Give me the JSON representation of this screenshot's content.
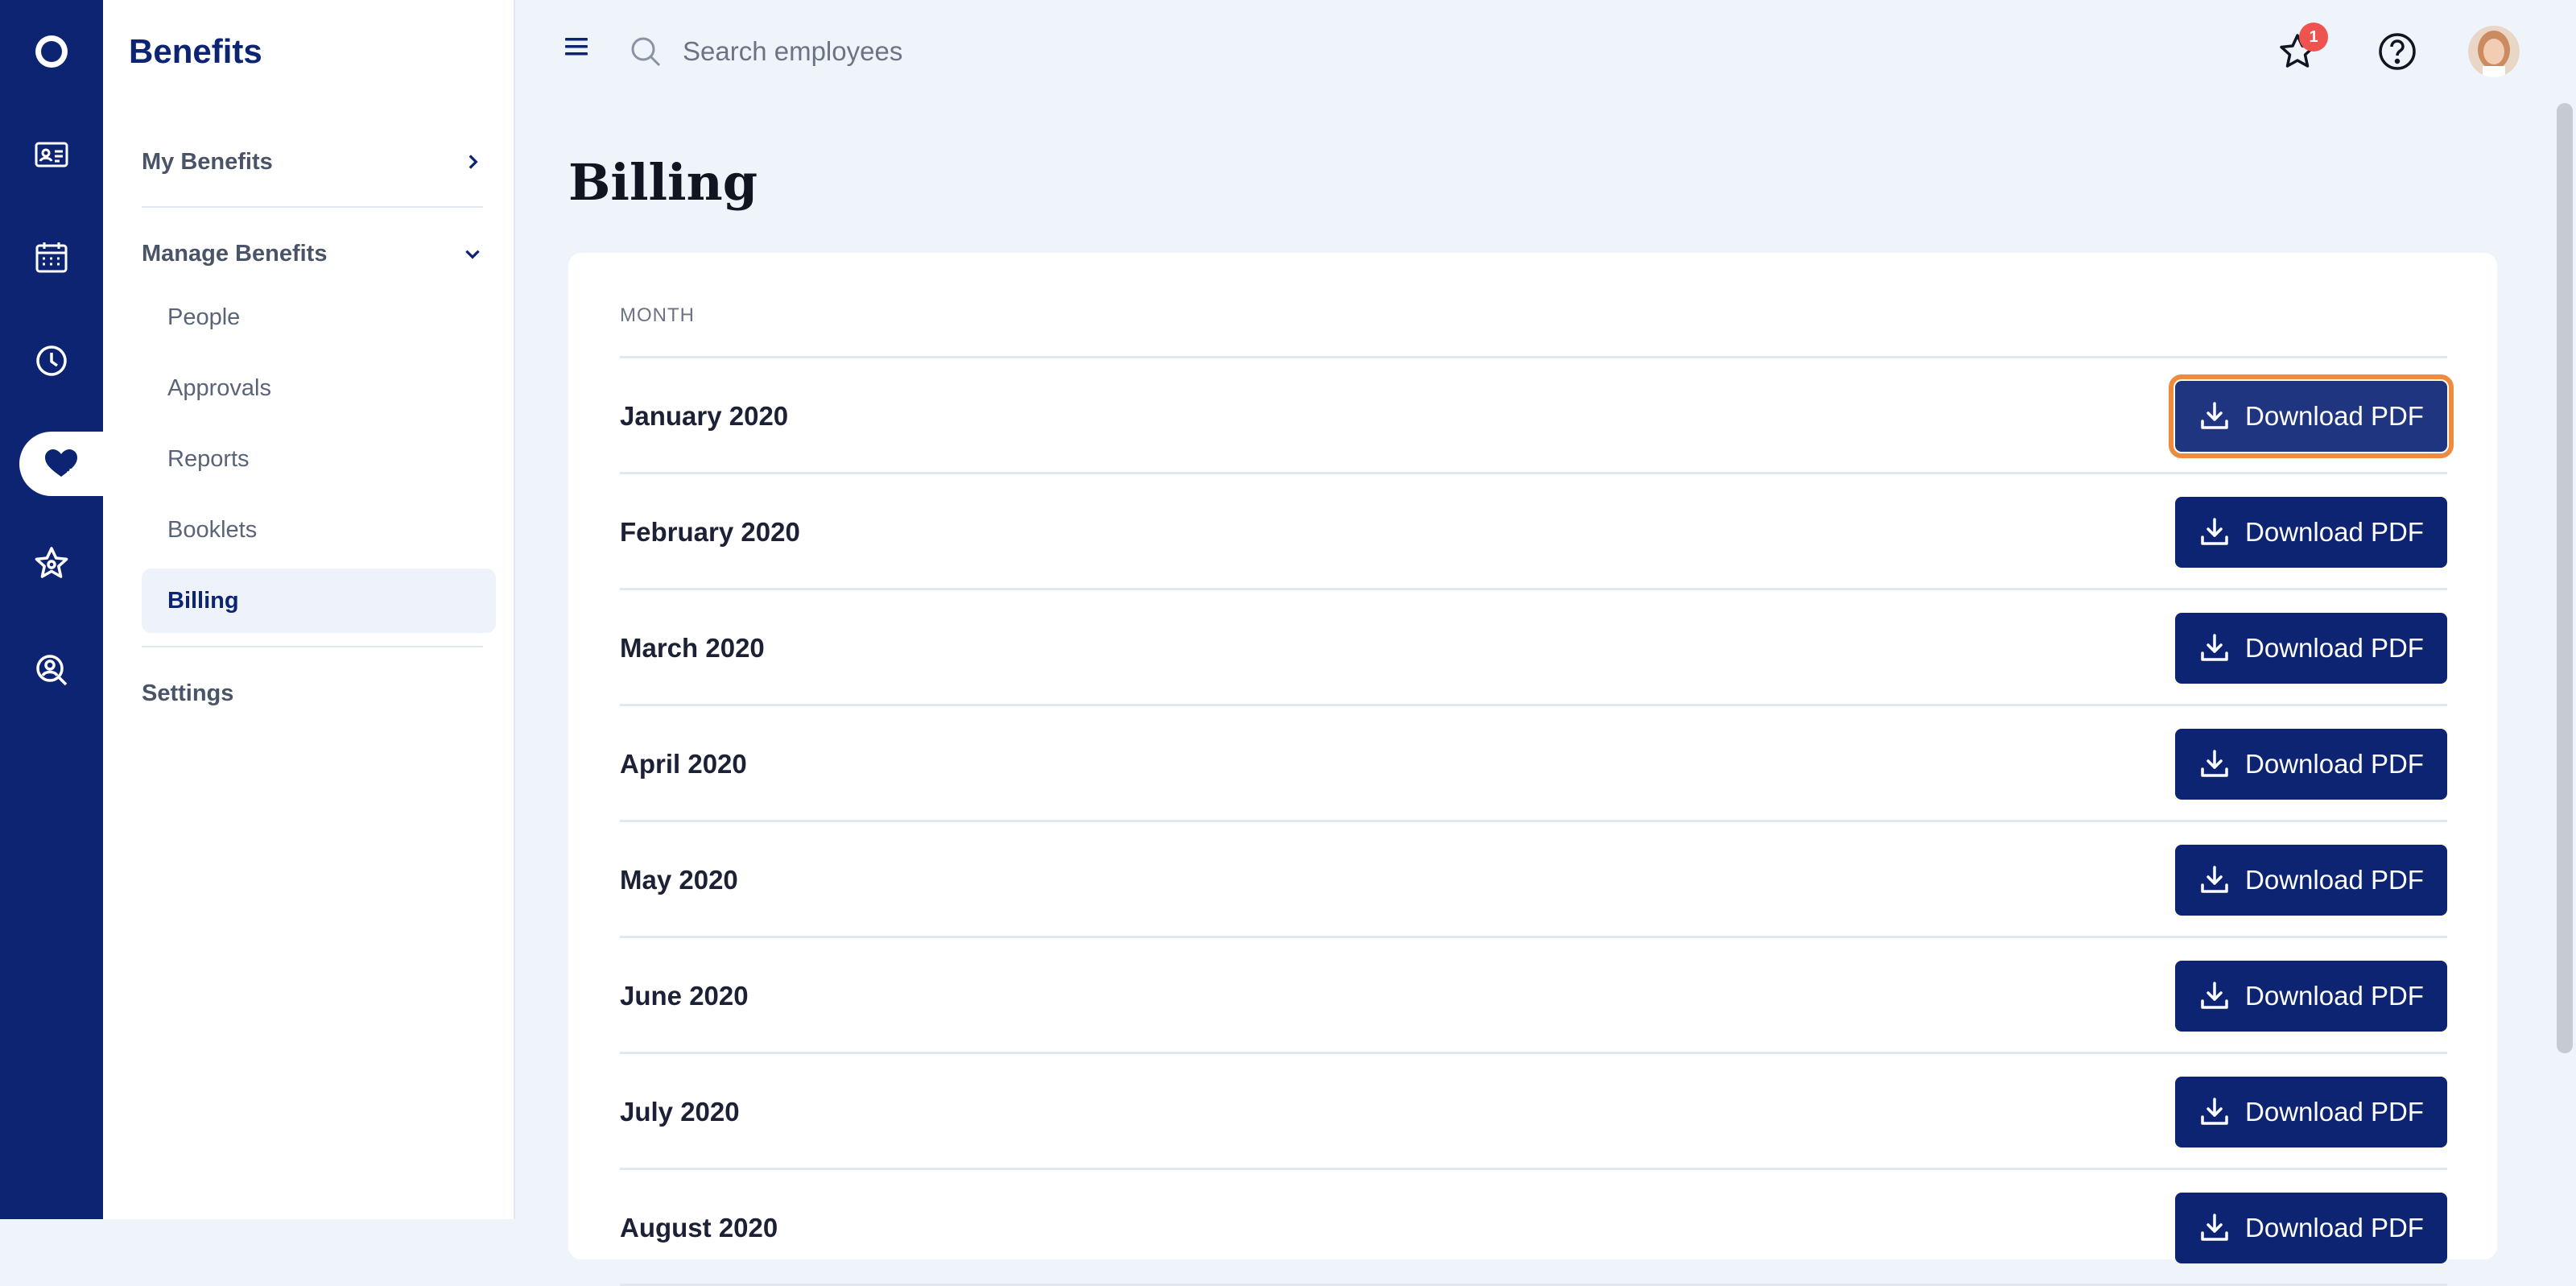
{
  "app": {
    "section_title": "Benefits"
  },
  "rail": {
    "icons": [
      "logo-icon",
      "id-card-icon",
      "calendar-icon",
      "clock-icon",
      "heart-icon",
      "star-icon",
      "search-user-icon"
    ],
    "active": "heart-icon"
  },
  "subnav": {
    "my_benefits": "My Benefits",
    "manage_benefits": "Manage Benefits",
    "items": [
      {
        "label": "People"
      },
      {
        "label": "Approvals"
      },
      {
        "label": "Reports"
      },
      {
        "label": "Booklets"
      },
      {
        "label": "Billing",
        "active": true
      }
    ],
    "settings": "Settings"
  },
  "topbar": {
    "search_placeholder": "Search employees",
    "notification_count": "1"
  },
  "page": {
    "title": "Billing",
    "column_header": "MONTH",
    "download_label": "Download PDF",
    "rows": [
      {
        "month": "January 2020",
        "focused": true
      },
      {
        "month": "February 2020"
      },
      {
        "month": "March 2020"
      },
      {
        "month": "April 2020"
      },
      {
        "month": "May 2020"
      },
      {
        "month": "June 2020"
      },
      {
        "month": "July 2020"
      },
      {
        "month": "August 2020"
      }
    ]
  },
  "colors": {
    "brand_navy": "#0d2472",
    "focus_orange": "#f08a3c",
    "badge_red": "#ef5350",
    "page_bg": "#eff3fa"
  }
}
